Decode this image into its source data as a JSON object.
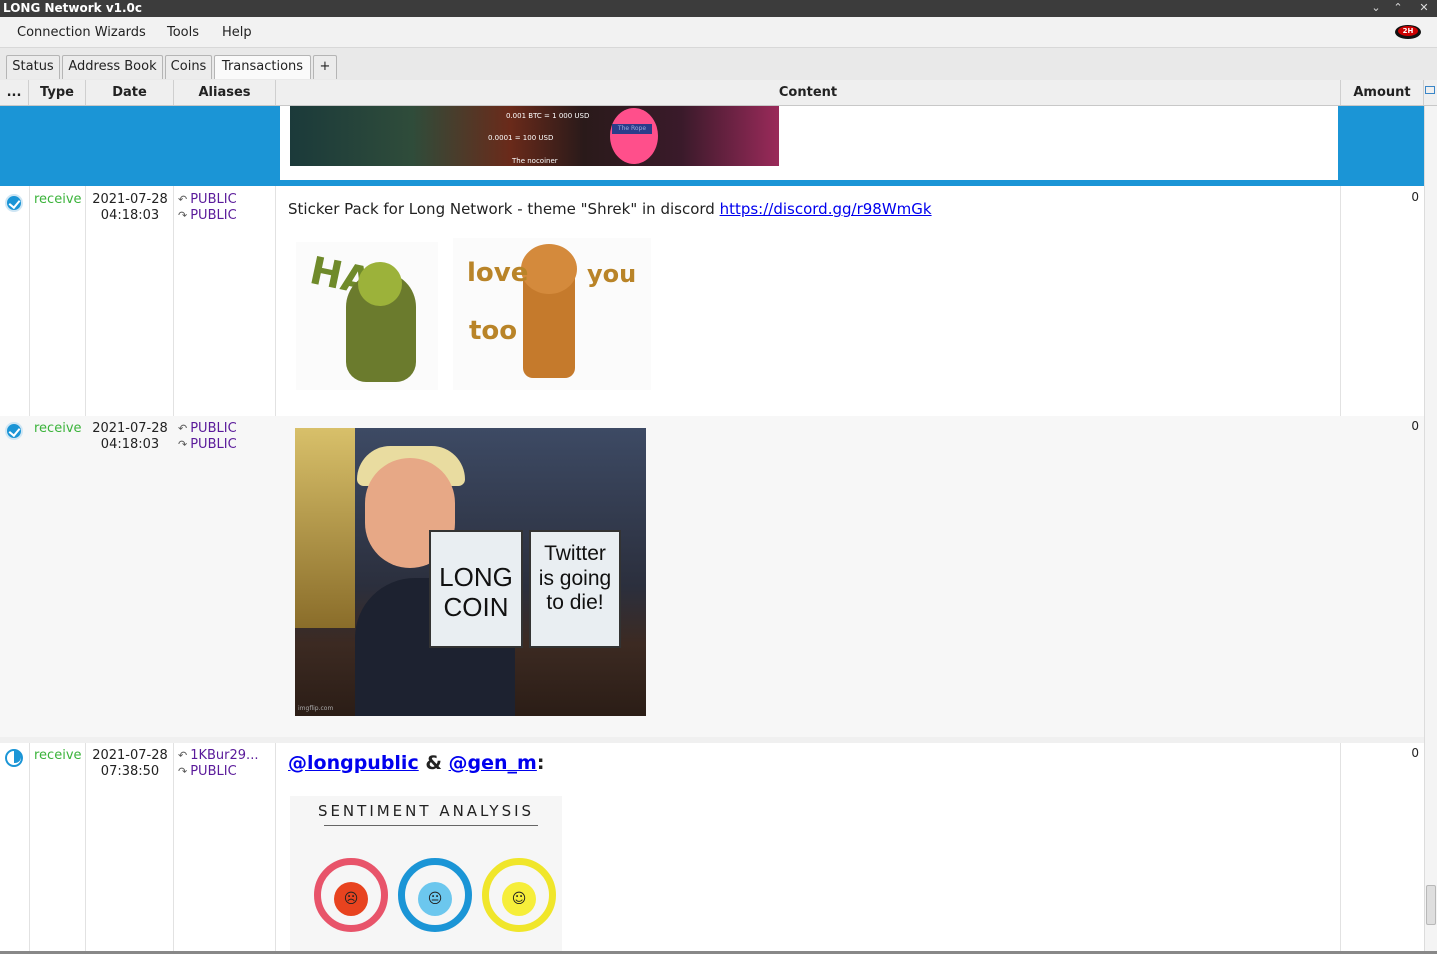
{
  "window": {
    "title": "LONG Network v1.0c",
    "controls": [
      "⌄",
      "⌃",
      "✕"
    ]
  },
  "menu": {
    "items": [
      "Connection Wizards",
      "Tools",
      "Help"
    ],
    "tor_label": "2H"
  },
  "tabs": [
    "Status",
    "Address Book",
    "Coins",
    "Transactions",
    "+"
  ],
  "table": {
    "headers": {
      "more": "...",
      "type": "Type",
      "date": "Date",
      "aliases": "Aliases",
      "content": "Content",
      "amount": "Amount"
    },
    "selected_row": {
      "labels": [
        "0.001 BTC = 1 000 USD",
        "0.0001 = 100 USD",
        "The nocoiner"
      ],
      "rope": "The Rope"
    },
    "rows": [
      {
        "type": "receive",
        "date": "2021-07-28",
        "time": "04:18:03",
        "from": "PUBLIC",
        "to": "PUBLIC",
        "amount": "0",
        "message": "Sticker Pack for Long Network - theme \"Shrek\" in discord ",
        "link": "https://discord.gg/r98WmGk",
        "sticker1": "HA",
        "sticker2": {
          "w1": "love",
          "w2": "you",
          "w3": "too"
        }
      },
      {
        "type": "receive",
        "date": "2021-07-28",
        "time": "04:18:03",
        "from": "PUBLIC",
        "to": "PUBLIC",
        "amount": "0",
        "meme_left": {
          "l1": "LONG",
          "l2": "COIN"
        },
        "meme_right": {
          "l1": "Twitter",
          "l2": "is going",
          "l3": "to die!"
        },
        "watermark": "imgflip.com"
      },
      {
        "type": "receive",
        "date": "2021-07-28",
        "time": "07:38:50",
        "from": "1KBur29...",
        "to": "PUBLIC",
        "amount": "0",
        "mention1": "@longpublic",
        "amp": " & ",
        "mention2": "@gen_m",
        "colon": ":",
        "image_title": "SENTIMENT ANALYSIS"
      }
    ]
  }
}
